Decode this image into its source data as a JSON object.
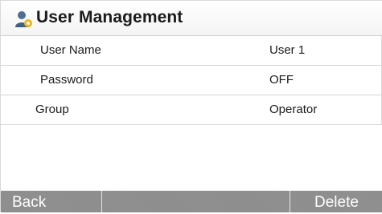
{
  "header": {
    "title": "User Management",
    "icon": "user-management-icon"
  },
  "rows": [
    {
      "label": "User Name",
      "value": "User 1"
    },
    {
      "label": "Password",
      "value": "OFF"
    },
    {
      "label": "Group",
      "value": "Operator"
    }
  ],
  "footer": {
    "back_label": "Back",
    "delete_label": "Delete"
  },
  "colors": {
    "footer_bg": "#8c8c8c",
    "text": "#1b1b1b",
    "footer_text": "#ffffff"
  }
}
